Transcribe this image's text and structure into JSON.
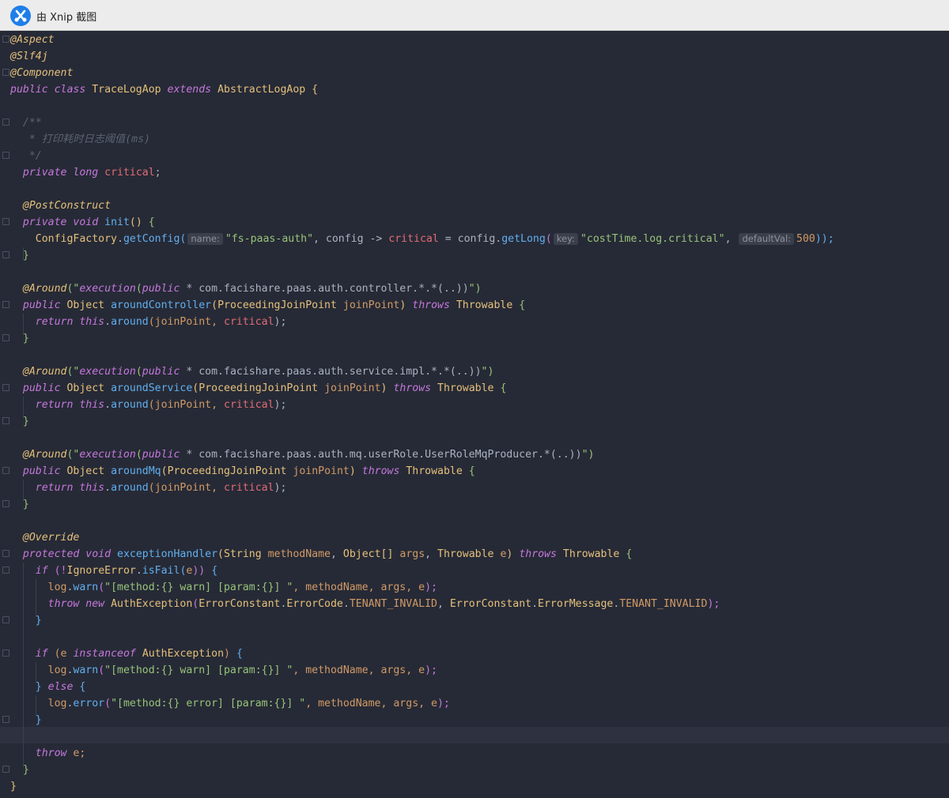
{
  "window": {
    "title": "由 Xnip 截图",
    "icon": "xnip-scissors-icon"
  },
  "hints": {
    "name": "name:",
    "key": "key:",
    "default_val": "defaultVal:"
  },
  "code": {
    "l1": "@Aspect",
    "l2": "@Slf4j",
    "l3": "@Component",
    "l4": [
      "public class",
      "TraceLogAop",
      "extends",
      "AbstractLogAop",
      "{"
    ],
    "l6": "/**",
    "l7": "* 打印耗时日志阈值(ms)",
    "l8": "*/",
    "l9": [
      "private long",
      "critical",
      ";"
    ],
    "l11": "@PostConstruct",
    "l12": [
      "private void",
      "init",
      "()",
      "{"
    ],
    "l13": [
      "ConfigFactory",
      ".",
      "getConfig",
      "(",
      "\"fs-paas-auth\"",
      ", config -> ",
      "critical",
      " = config.",
      "getLong",
      "(",
      "\"costTime.log.critical\"",
      ", ",
      "500",
      "));"
    ],
    "l14": "}",
    "l16": [
      "@Around",
      "(\"",
      "execution",
      "(",
      "public",
      " * com.facishare.paas.auth.controller.*.*(..))",
      "\")"
    ],
    "l17": [
      "public",
      "Object",
      "aroundController",
      "(",
      "ProceedingJoinPoint",
      "joinPoint",
      ")",
      "throws",
      "Throwable",
      "{"
    ],
    "l18": [
      "return",
      "this",
      ".",
      "around",
      "(joinPoint, ",
      "critical",
      ");"
    ],
    "l19": "}",
    "l21": [
      "@Around",
      "(\"",
      "execution",
      "(",
      "public",
      " * com.facishare.paas.auth.service.impl.*.*(..))",
      "\")"
    ],
    "l22": [
      "public",
      "Object",
      "aroundService",
      "(",
      "ProceedingJoinPoint",
      "joinPoint",
      ")",
      "throws",
      "Throwable",
      "{"
    ],
    "l23": [
      "return",
      "this",
      ".",
      "around",
      "(joinPoint, ",
      "critical",
      ");"
    ],
    "l24": "}",
    "l26": [
      "@Around",
      "(\"",
      "execution",
      "(",
      "public",
      " * com.facishare.paas.auth.mq.userRole.UserRoleMqProducer.*(..))",
      "\")"
    ],
    "l27": [
      "public",
      "Object",
      "aroundMq",
      "(",
      "ProceedingJoinPoint",
      "joinPoint",
      ")",
      "throws",
      "Throwable",
      "{"
    ],
    "l28": [
      "return",
      "this",
      ".",
      "around",
      "(joinPoint, ",
      "critical",
      ");"
    ],
    "l29": "}",
    "l31": "@Override",
    "l32": [
      "protected void",
      "exceptionHandler",
      "(",
      "String",
      "methodName",
      ", ",
      "Object[]",
      "args",
      ", ",
      "Throwable",
      "e",
      ")",
      "throws",
      "Throwable",
      "{"
    ],
    "l33": [
      "if",
      "(!",
      "IgnoreError",
      ".",
      "isFail",
      "(",
      "e",
      "))",
      "{"
    ],
    "l34": [
      "log",
      ".",
      "warn",
      "(",
      "\"[method:{} warn] [param:{}] \"",
      ", methodName, args, e",
      ");"
    ],
    "l35": [
      "throw new",
      "AuthException",
      "(",
      "ErrorConstant",
      ".",
      "ErrorCode",
      ".",
      "TENANT_INVALID",
      ", ",
      "ErrorConstant",
      ".",
      "ErrorMessage",
      ".",
      "TENANT_INVALID",
      ");"
    ],
    "l36": "}",
    "l38": [
      "if",
      "(e",
      "instanceof",
      "AuthException",
      ")",
      "{"
    ],
    "l39": [
      "log",
      ".",
      "warn",
      "(",
      "\"[method:{} warn] [param:{}] \"",
      ", methodName, args, e",
      ");"
    ],
    "l40": [
      "}",
      "else",
      "{"
    ],
    "l41": [
      "log",
      ".",
      "error",
      "(",
      "\"[method:{} error] [param:{}] \"",
      ", methodName, args, e",
      ");"
    ],
    "l42": "}",
    "l44": [
      "throw",
      "e;"
    ],
    "l45": "}",
    "l46": "}"
  }
}
